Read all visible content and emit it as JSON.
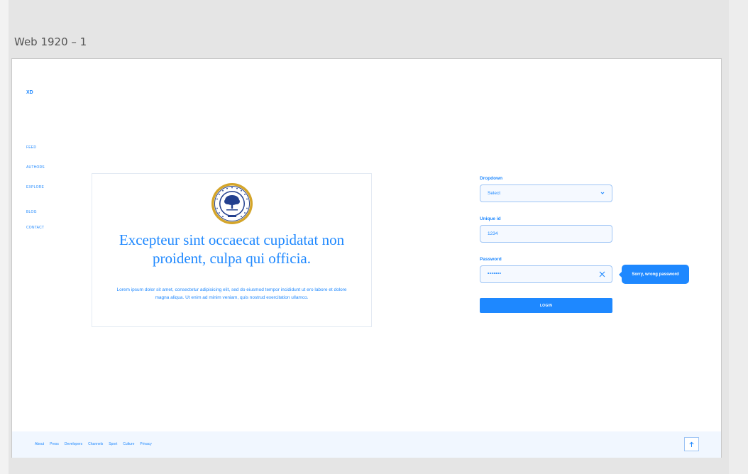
{
  "artboard": {
    "title": "Web 1920 – 1"
  },
  "brand": {
    "logo": "XD"
  },
  "nav": {
    "items": [
      {
        "label": "FEED"
      },
      {
        "label": "AUTHORS"
      },
      {
        "label": "EXPLORE"
      },
      {
        "label": "BLOG"
      },
      {
        "label": "CONTACT"
      }
    ]
  },
  "card": {
    "seal_icon": "university-seal-icon",
    "heading": "Excepteur sint occaecat cupidatat non proident, culpa qui officia.",
    "text": "Lorem ipsum dolor sit amet, consectetur adipisicing elit, sed do eiusmod tempor incididunt ut ero labore et dolore magna aliqua. Ut enim ad minim veniam, quis nostrud exercitation ullamco."
  },
  "form": {
    "dropdown": {
      "label": "Dropdown",
      "value": "Select",
      "icon": "chevron-down-icon"
    },
    "unique_id": {
      "label": "Unique id",
      "value": "1234"
    },
    "password": {
      "label": "Password",
      "value": "•••••••",
      "icon": "close-icon"
    },
    "error_tooltip": "Sorry, wrong password",
    "login_label": "LOGIN"
  },
  "footer": {
    "links": [
      "About",
      "Press",
      "Developers",
      "Channels",
      "Sport",
      "Culture",
      "Privacy"
    ],
    "scroll_icon": "arrow-up-icon"
  },
  "colors": {
    "accent": "#1e88ff",
    "field_border": "#9fc5f5",
    "field_bg": "#f5f9ff",
    "footer_bg": "#f1f7ff",
    "canvas_bg": "#e5e5e5",
    "seal_gold": "#d4a52a",
    "seal_navy": "#23408e"
  }
}
